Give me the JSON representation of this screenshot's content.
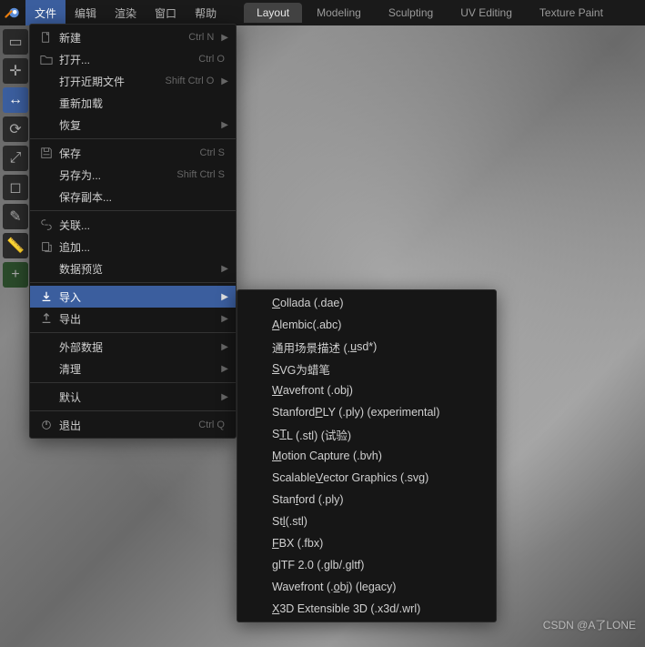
{
  "topmenu": {
    "items": [
      "文件",
      "编辑",
      "渲染",
      "窗口",
      "帮助"
    ],
    "active_index": 0
  },
  "workspaces": {
    "tabs": [
      "Layout",
      "Modeling",
      "Sculpting",
      "UV Editing",
      "Texture Paint"
    ],
    "active_index": 0
  },
  "file_menu": {
    "rows": [
      {
        "icon": "new",
        "label": "新建",
        "shortcut": "Ctrl N",
        "arrow": true
      },
      {
        "icon": "folder",
        "label": "打开...",
        "shortcut": "Ctrl O"
      },
      {
        "label": "打开近期文件",
        "shortcut": "Shift Ctrl O",
        "arrow": true
      },
      {
        "label": "重新加载"
      },
      {
        "label": "恢复",
        "arrow": true
      },
      {
        "sep": true
      },
      {
        "icon": "save",
        "label": "保存",
        "shortcut": "Ctrl S"
      },
      {
        "label": "另存为...",
        "shortcut": "Shift Ctrl S"
      },
      {
        "label": "保存副本..."
      },
      {
        "sep": true
      },
      {
        "icon": "link",
        "label": "关联..."
      },
      {
        "icon": "append",
        "label": "追加..."
      },
      {
        "label": "数据预览",
        "arrow": true
      },
      {
        "sep": true
      },
      {
        "icon": "import",
        "label": "导入",
        "arrow": true,
        "highlight": true
      },
      {
        "icon": "export",
        "label": "导出",
        "arrow": true
      },
      {
        "sep": true
      },
      {
        "label": "外部数据",
        "arrow": true
      },
      {
        "label": "清理",
        "arrow": true
      },
      {
        "sep": true
      },
      {
        "label": "默认",
        "arrow": true
      },
      {
        "sep": true
      },
      {
        "icon": "quit",
        "label": "退出",
        "shortcut": "Ctrl Q"
      }
    ]
  },
  "import_submenu": {
    "items": [
      {
        "u": "C",
        "rest": "ollada (.dae)"
      },
      {
        "u": "A",
        "rest": "lembic(.abc)"
      },
      {
        "pre": "通用场景描述 (.",
        "u": "u",
        "rest": "sd*)"
      },
      {
        "u": "S",
        "rest": "VG为蜡笔"
      },
      {
        "u": "W",
        "rest": "avefront (.obj)"
      },
      {
        "pre": "Stanford ",
        "u": "P",
        "rest": "LY (.ply) (experimental)"
      },
      {
        "pre": "S",
        "u": "T",
        "rest": "L (.stl) (试验)"
      },
      {
        "u": "M",
        "rest": "otion Capture (.bvh)"
      },
      {
        "pre": "Scalable ",
        "u": "V",
        "rest": "ector Graphics (.svg)"
      },
      {
        "pre": "Stan",
        "u": "f",
        "rest": "ord (.ply)"
      },
      {
        "pre": "St",
        "u": "l",
        "rest": " (.stl)"
      },
      {
        "u": "F",
        "rest": "BX (.fbx)"
      },
      {
        "pre": "glTF 2.0 (.glb/.",
        "u": "g",
        "rest": "ltf)"
      },
      {
        "pre": "Wavefront (.",
        "u": "o",
        "rest": "bj) (legacy)"
      },
      {
        "u": "X",
        "rest": "3D Extensible 3D (.x3d/.wrl)"
      }
    ]
  },
  "watermark": "CSDN @A了LONE"
}
